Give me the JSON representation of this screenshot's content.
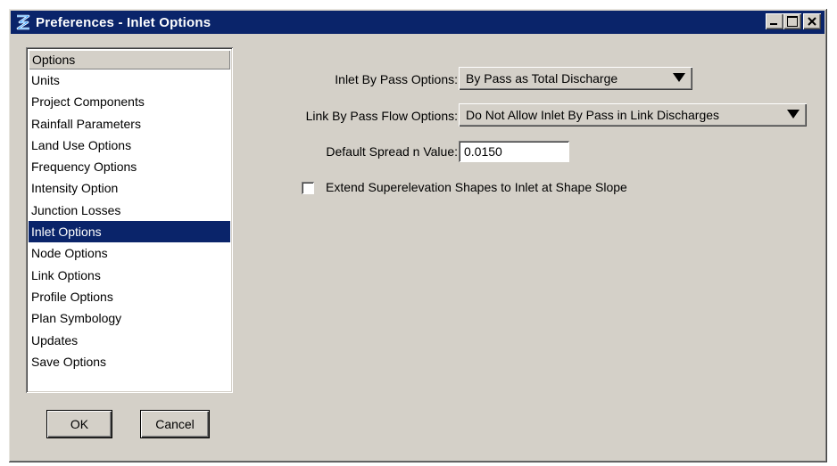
{
  "window": {
    "title": "Preferences - Inlet Options",
    "icon": "app-logo-icon",
    "title_bar_color": "#0a246a"
  },
  "options_list": {
    "header": "Options",
    "selected_index": 7,
    "items": [
      {
        "label": "Units"
      },
      {
        "label": "Project Components"
      },
      {
        "label": "Rainfall Parameters"
      },
      {
        "label": "Land Use Options"
      },
      {
        "label": "Frequency Options"
      },
      {
        "label": "Intensity Option"
      },
      {
        "label": "Junction Losses"
      },
      {
        "label": "Inlet Options"
      },
      {
        "label": "Node Options"
      },
      {
        "label": "Link Options"
      },
      {
        "label": "Profile Options"
      },
      {
        "label": "Plan Symbology"
      },
      {
        "label": "Updates"
      },
      {
        "label": "Save Options"
      }
    ]
  },
  "buttons": {
    "ok": "OK",
    "cancel": "Cancel"
  },
  "form": {
    "inlet_bypass": {
      "label": "Inlet By Pass Options:",
      "value": "By Pass as Total Discharge"
    },
    "link_bypass": {
      "label": "Link By Pass Flow Options:",
      "value": "Do Not Allow Inlet By Pass in Link Discharges"
    },
    "spread_n": {
      "label": "Default Spread n Value:",
      "value": "0.0150"
    },
    "extend_superelevation": {
      "label": "Extend Superelevation Shapes to Inlet at Shape Slope",
      "checked": false
    }
  }
}
